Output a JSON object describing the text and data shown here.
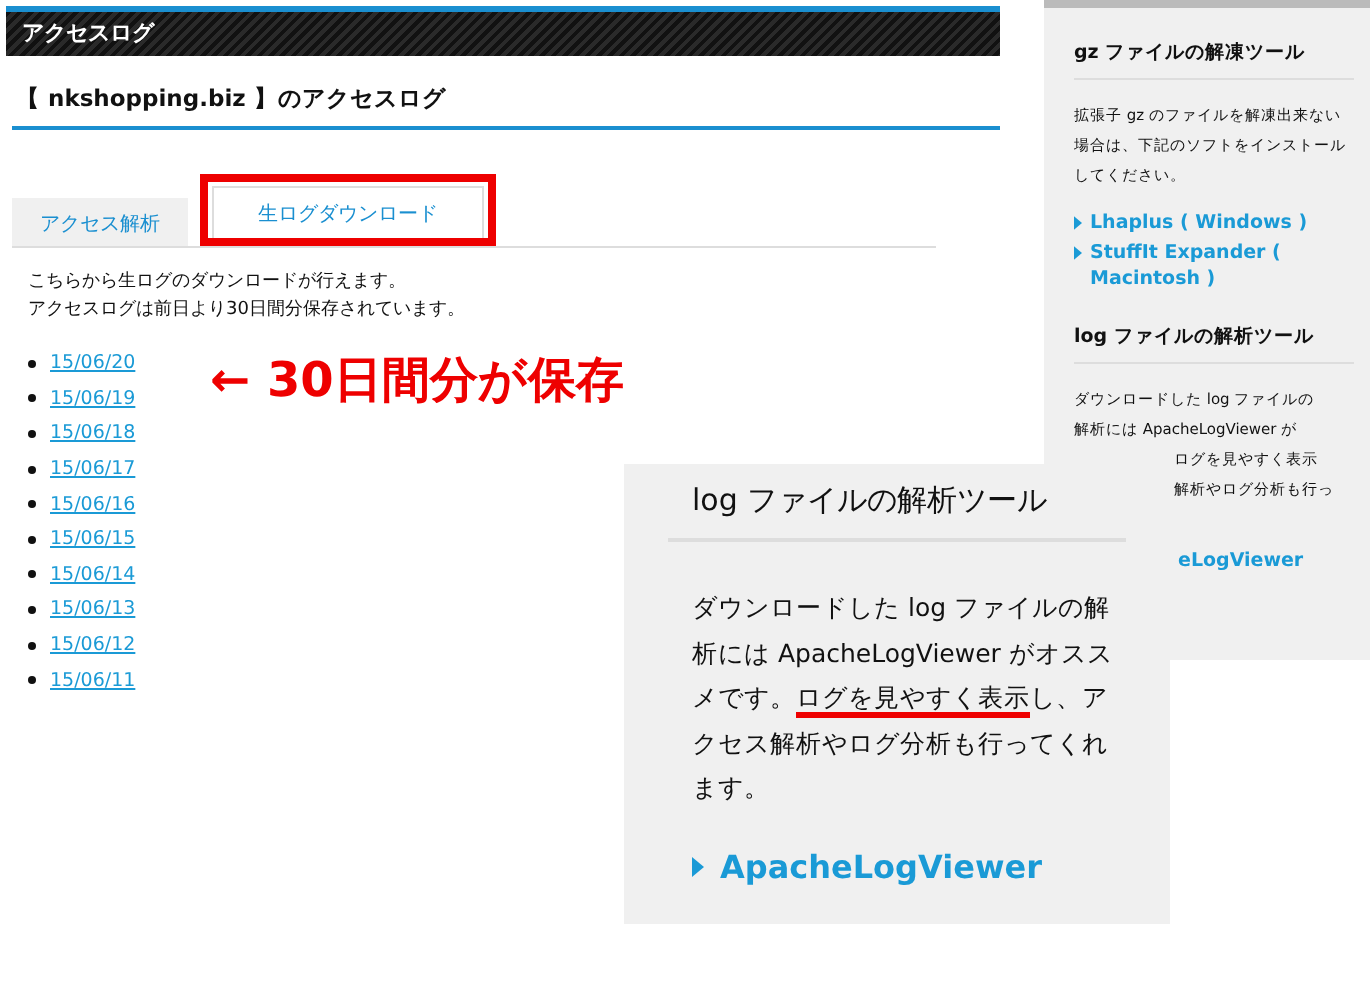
{
  "main": {
    "header": "アクセスログ",
    "title": "【 nkshopping.biz 】のアクセスログ",
    "tabs": [
      {
        "label": "アクセス解析",
        "selected": false,
        "annotated": false
      },
      {
        "label": "生ログダウンロード",
        "selected": true,
        "annotated": true
      }
    ],
    "intro": [
      "こちらから生ログのダウンロードが行えます。",
      "アクセスログは前日より30日間分保存されています。"
    ],
    "dates": [
      "15/06/20",
      "15/06/19",
      "15/06/18",
      "15/06/17",
      "15/06/16",
      "15/06/15",
      "15/06/14",
      "15/06/13",
      "15/06/12",
      "15/06/11"
    ],
    "annotation": "← 30日間分が保存"
  },
  "sidebar": {
    "sections": [
      {
        "heading": "gz ファイルの解凍ツール",
        "lines": [
          {
            "text": "拡張子 gz のファイルを解凍出来ない場合は、下記のソフトをインストールしてください。",
            "kind": "full"
          }
        ],
        "links": [
          "Lhaplus ( Windows )",
          "StuffIt Expander ( Macintosh )"
        ]
      },
      {
        "heading": "log ファイルの解析ツール",
        "lines": [
          {
            "text": "ダウンロードした log ファイルの",
            "kind": "full"
          },
          {
            "text": "解析には ApacheLogViewer が",
            "kind": "full"
          },
          {
            "text": "ログを見やすく表示",
            "kind": "partial"
          },
          {
            "text": "解析やログ分析も行っ",
            "kind": "partial"
          }
        ],
        "partial_link": "eLogViewer"
      }
    ]
  },
  "zoom_panel": {
    "heading": "log ファイルの解析ツール",
    "paragraph": [
      {
        "text": "ダウンロードした log ファイルの解析には ApacheLogViewer がオススメです。",
        "highlighted": false
      },
      {
        "text": "ログを見やすく表示",
        "highlighted": true
      },
      {
        "text": "し、アクセス解析やログ分析も行ってくれます。",
        "highlighted": false
      }
    ],
    "link": "ApacheLogViewer"
  }
}
